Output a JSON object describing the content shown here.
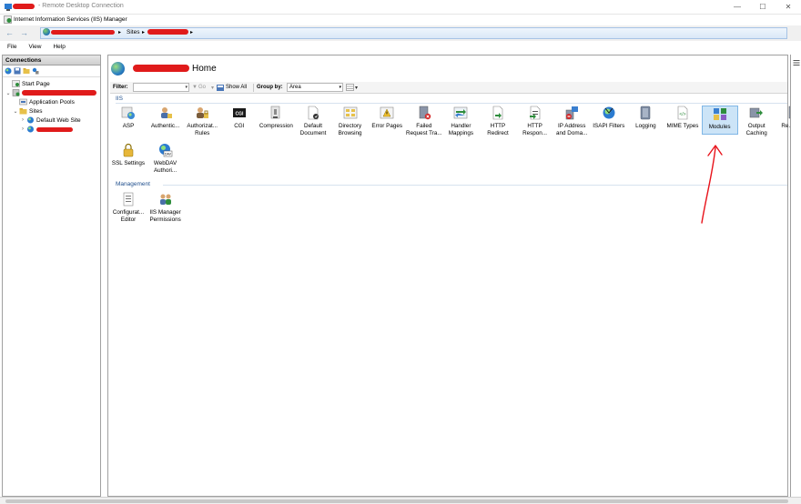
{
  "rdp": {
    "title": "- Remote Desktop Connection",
    "minimize": "—",
    "maximize": "☐",
    "close": "✕"
  },
  "app": {
    "title": "Internet Information Services (IIS) Manager"
  },
  "address": {
    "sites": "Sites",
    "sep": "▸"
  },
  "menu": [
    "File",
    "View",
    "Help"
  ],
  "connections": {
    "header": "Connections",
    "tree": [
      {
        "label": "Start Page",
        "indent": 0,
        "expander": ""
      },
      {
        "label": "",
        "indent": 0,
        "expander": "⌄",
        "redacted": true
      },
      {
        "label": "Application Pools",
        "indent": 1,
        "expander": ""
      },
      {
        "label": "Sites",
        "indent": 1,
        "expander": "⌄"
      },
      {
        "label": "Default Web Site",
        "indent": 2,
        "expander": "›"
      },
      {
        "label": "",
        "indent": 2,
        "expander": "›",
        "redacted": true
      }
    ]
  },
  "home": {
    "title": "Home"
  },
  "filterbar": {
    "filter_label": "Filter:",
    "go_label": "Go",
    "show_all_label": "Show All",
    "group_by_label": "Group by:",
    "group_by_value": "Area"
  },
  "sections": {
    "iis": {
      "label": "IIS",
      "features": [
        {
          "label": "ASP",
          "icon": "asp-icon"
        },
        {
          "label": "Authentic...",
          "icon": "authentication-icon"
        },
        {
          "label": "Authorizat... Rules",
          "icon": "authorization-icon"
        },
        {
          "label": "CGI",
          "icon": "cgi-icon"
        },
        {
          "label": "Compression",
          "icon": "compression-icon"
        },
        {
          "label": "Default Document",
          "icon": "default-document-icon"
        },
        {
          "label": "Directory Browsing",
          "icon": "directory-browsing-icon"
        },
        {
          "label": "Error Pages",
          "icon": "error-pages-icon"
        },
        {
          "label": "Failed Request Tra...",
          "icon": "failed-request-icon"
        },
        {
          "label": "Handler Mappings",
          "icon": "handler-mappings-icon"
        },
        {
          "label": "HTTP Redirect",
          "icon": "http-redirect-icon"
        },
        {
          "label": "HTTP Respon...",
          "icon": "http-response-icon"
        },
        {
          "label": "IP Address and Doma...",
          "icon": "ip-address-icon"
        },
        {
          "label": "ISAPI Filters",
          "icon": "isapi-filters-icon"
        },
        {
          "label": "Logging",
          "icon": "logging-icon"
        },
        {
          "label": "MIME Types",
          "icon": "mime-types-icon"
        },
        {
          "label": "Modules",
          "icon": "modules-icon",
          "selected": true
        },
        {
          "label": "Output Caching",
          "icon": "output-caching-icon"
        },
        {
          "label": "Re... Fil...",
          "icon": "request-filtering-icon"
        },
        {
          "label": "SSL Settings",
          "icon": "ssl-settings-icon"
        },
        {
          "label": "WebDAV Authori...",
          "icon": "webdav-icon"
        }
      ]
    },
    "management": {
      "label": "Management",
      "features": [
        {
          "label": "Configurat... Editor",
          "icon": "configuration-editor-icon"
        },
        {
          "label": "IIS Manager Permissions",
          "icon": "iis-manager-permissions-icon"
        }
      ]
    }
  },
  "colors": {
    "accent": "#1e4e8c",
    "selection": "#cce4f7",
    "annotation": "#e8141c",
    "redaction": "#e01b1b"
  }
}
